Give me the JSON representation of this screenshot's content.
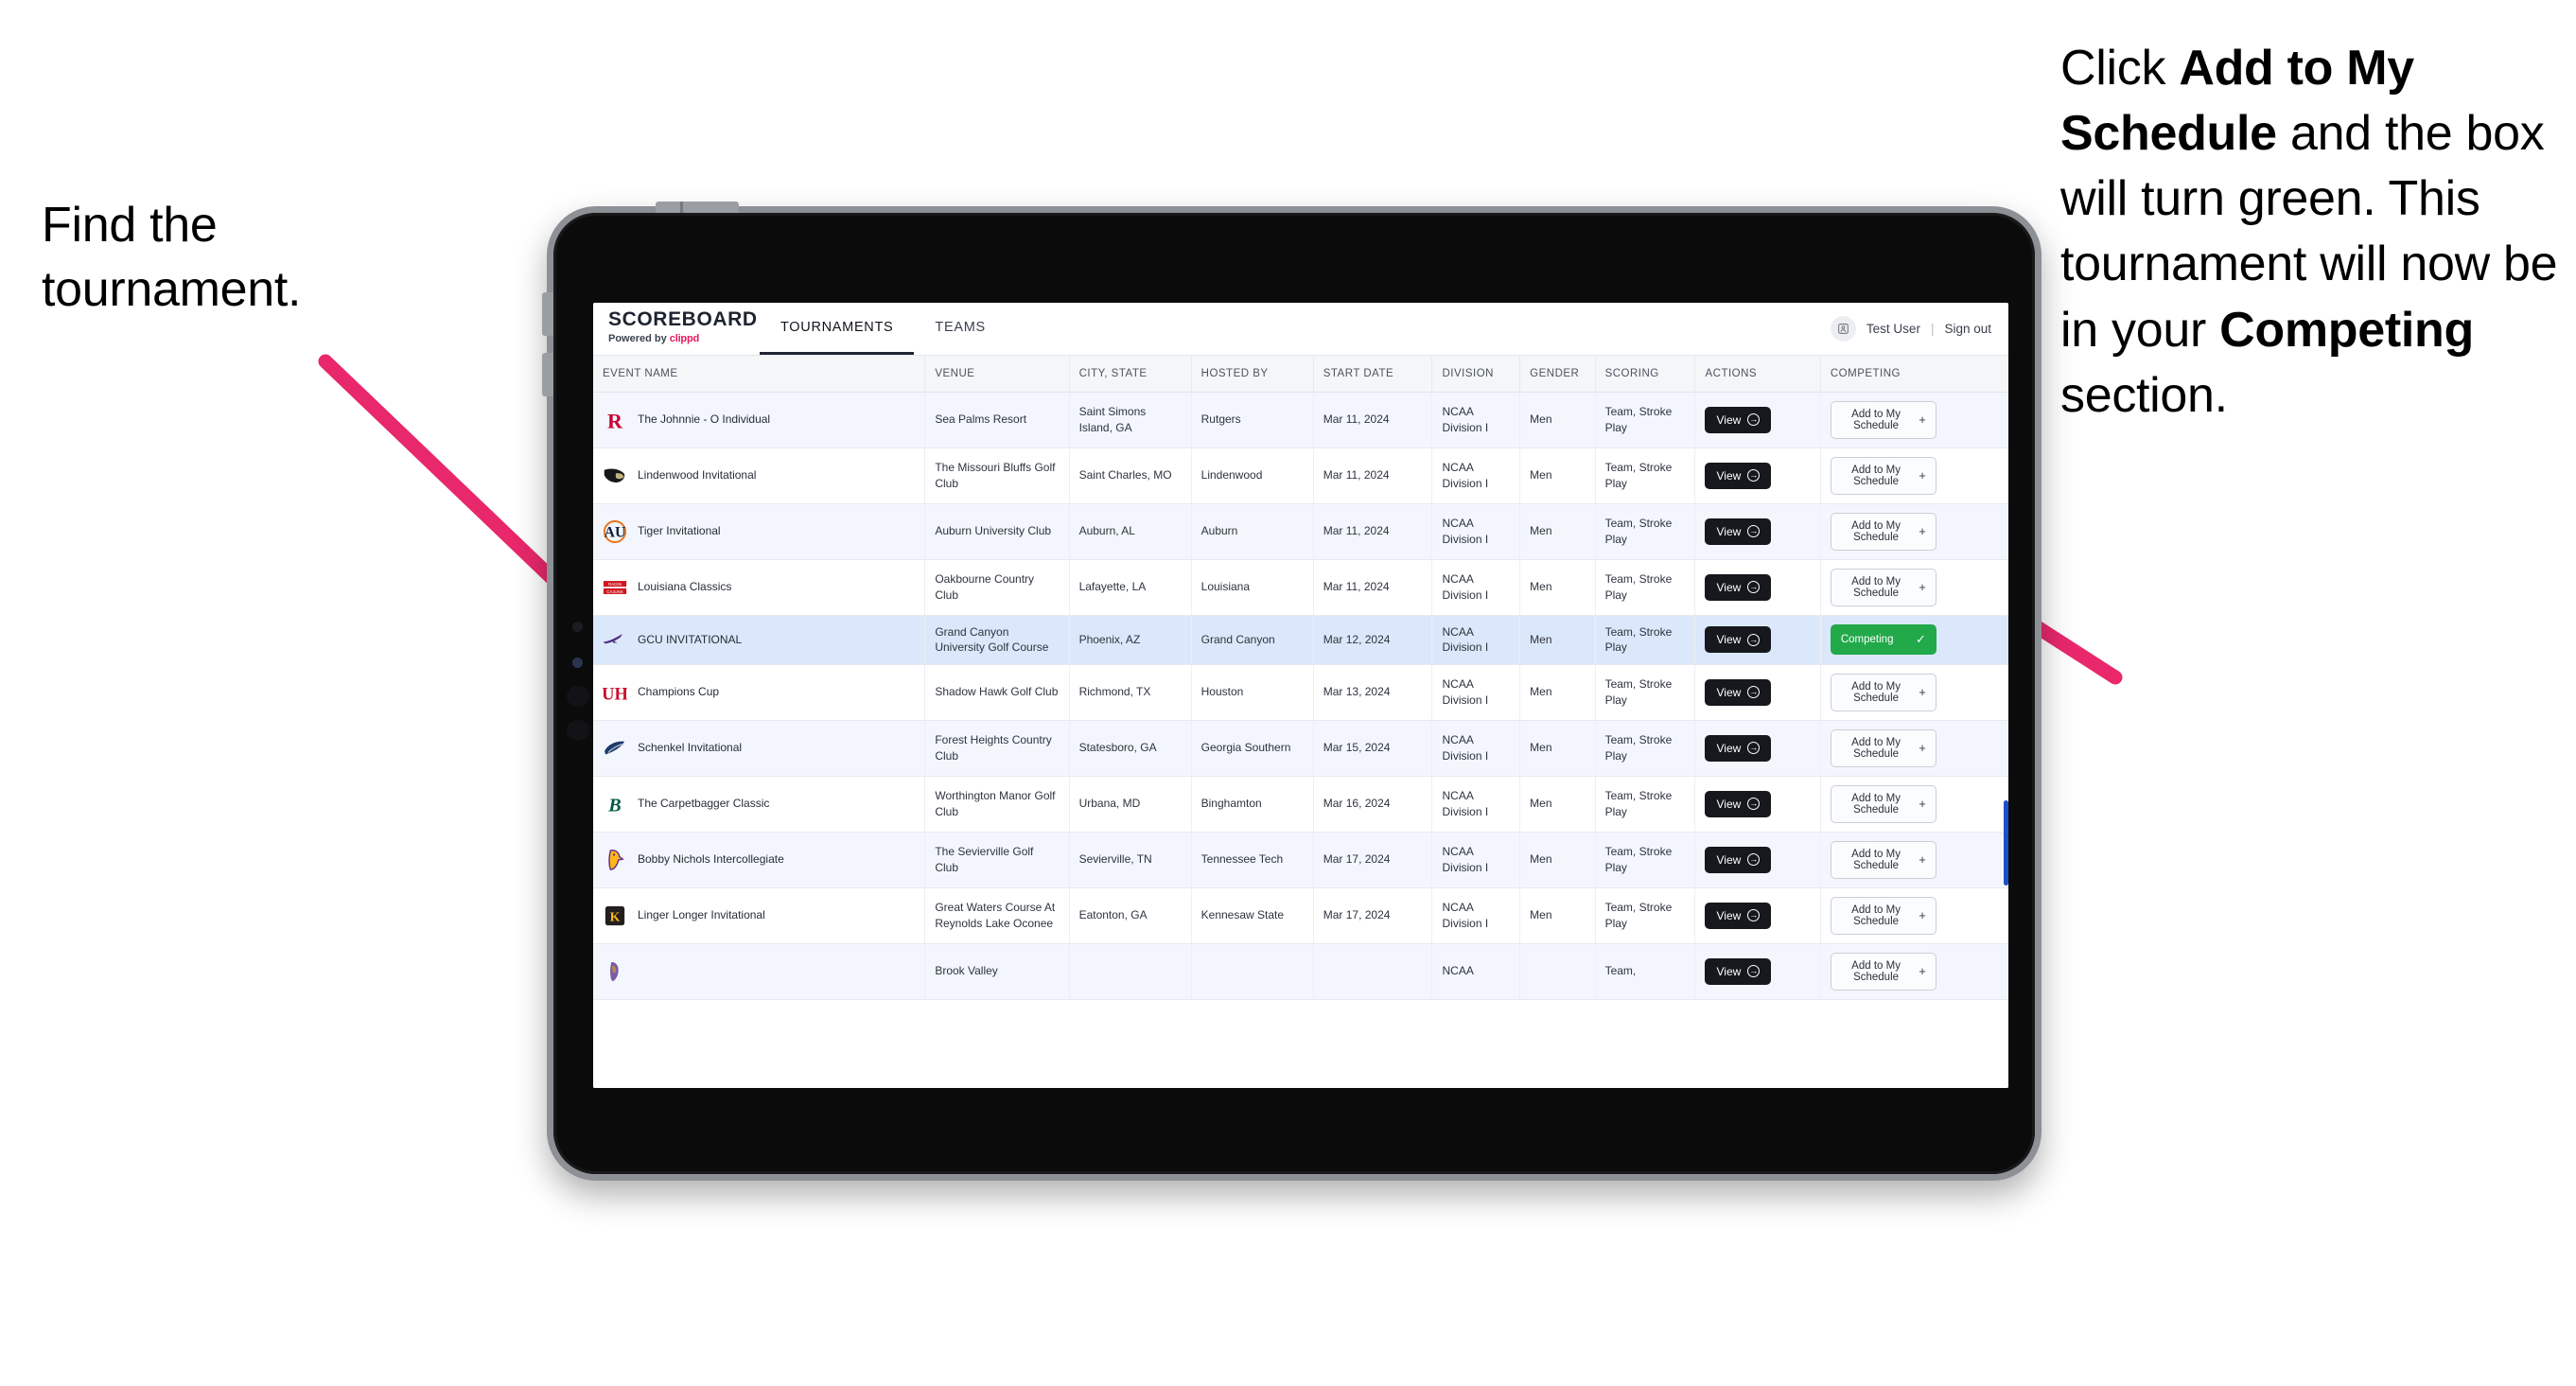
{
  "annotations": {
    "left": "Find the tournament.",
    "right_parts": [
      {
        "text": "Click ",
        "bold": false
      },
      {
        "text": "Add to My Schedule",
        "bold": true
      },
      {
        "text": " and the box will turn green. This tournament will now be in your ",
        "bold": false
      },
      {
        "text": "Competing",
        "bold": true
      },
      {
        "text": " section.",
        "bold": false
      }
    ],
    "arrow_color": "#e8286b"
  },
  "app": {
    "brand": {
      "name": "SCOREBOARD",
      "powered_prefix": "Powered by ",
      "powered_brand": "clippd"
    },
    "tabs": [
      {
        "label": "TOURNAMENTS",
        "active": true
      },
      {
        "label": "TEAMS",
        "active": false
      }
    ],
    "header_right": {
      "avatar_icon": "user-avatar-icon",
      "user": "Test User",
      "separator": "|",
      "signout": "Sign out"
    },
    "columns": [
      "EVENT NAME",
      "VENUE",
      "CITY, STATE",
      "HOSTED BY",
      "START DATE",
      "DIVISION",
      "GENDER",
      "SCORING",
      "ACTIONS",
      "COMPETING"
    ],
    "buttons": {
      "view": "View",
      "add": "Add to My Schedule",
      "add_plus": "+",
      "competing": "Competing",
      "competing_check": "✓"
    },
    "rows": [
      {
        "logo": "rutgers-logo",
        "logo_text": "R",
        "logo_color": "#cc0033",
        "event": "The Johnnie - O Individual",
        "venue": "Sea Palms Resort",
        "city": "Saint Simons Island, GA",
        "host": "Rutgers",
        "date": "Mar 11, 2024",
        "division": "NCAA Division I",
        "gender": "Men",
        "scoring": "Team, Stroke Play",
        "competing": false
      },
      {
        "logo": "lindenwood-lion-logo",
        "logo_text": "",
        "logo_color": "#1d1d1b",
        "event": "Lindenwood Invitational",
        "venue": "The Missouri Bluffs Golf Club",
        "city": "Saint Charles, MO",
        "host": "Lindenwood",
        "date": "Mar 11, 2024",
        "division": "NCAA Division I",
        "gender": "Men",
        "scoring": "Team, Stroke Play",
        "competing": false
      },
      {
        "logo": "auburn-logo",
        "logo_text": "AU",
        "logo_color": "#0c2340",
        "event": "Tiger Invitational",
        "venue": "Auburn University Club",
        "city": "Auburn, AL",
        "host": "Auburn",
        "date": "Mar 11, 2024",
        "division": "NCAA Division I",
        "gender": "Men",
        "scoring": "Team, Stroke Play",
        "competing": false
      },
      {
        "logo": "ragin-cajuns-logo",
        "logo_text": "RAGIN CAJUNS",
        "logo_color": "#ce181e",
        "event": "Louisiana Classics",
        "venue": "Oakbourne Country Club",
        "city": "Lafayette, LA",
        "host": "Louisiana",
        "date": "Mar 11, 2024",
        "division": "NCAA Division I",
        "gender": "Men",
        "scoring": "Team, Stroke Play",
        "competing": false
      },
      {
        "logo": "grand-canyon-lopes-logo",
        "logo_text": "",
        "logo_color": "#4f2d7f",
        "event": "GCU INVITATIONAL",
        "venue": "Grand Canyon University Golf Course",
        "city": "Phoenix, AZ",
        "host": "Grand Canyon",
        "date": "Mar 12, 2024",
        "division": "NCAA Division I",
        "gender": "Men",
        "scoring": "Team, Stroke Play",
        "competing": true
      },
      {
        "logo": "houston-logo",
        "logo_text": "UH",
        "logo_color": "#c8102e",
        "event": "Champions Cup",
        "venue": "Shadow Hawk Golf Club",
        "city": "Richmond, TX",
        "host": "Houston",
        "date": "Mar 13, 2024",
        "division": "NCAA Division I",
        "gender": "Men",
        "scoring": "Team, Stroke Play",
        "competing": false
      },
      {
        "logo": "georgia-southern-logo",
        "logo_text": "GS",
        "logo_color": "#1a3a6b",
        "event": "Schenkel Invitational",
        "venue": "Forest Heights Country Club",
        "city": "Statesboro, GA",
        "host": "Georgia Southern",
        "date": "Mar 15, 2024",
        "division": "NCAA Division I",
        "gender": "Men",
        "scoring": "Team, Stroke Play",
        "competing": false
      },
      {
        "logo": "binghamton-logo",
        "logo_text": "B",
        "logo_color": "#005a43",
        "event": "The Carpetbagger Classic",
        "venue": "Worthington Manor Golf Club",
        "city": "Urbana, MD",
        "host": "Binghamton",
        "date": "Mar 16, 2024",
        "division": "NCAA Division I",
        "gender": "Men",
        "scoring": "Team, Stroke Play",
        "competing": false
      },
      {
        "logo": "tennessee-tech-logo",
        "logo_text": "",
        "logo_color": "#6b2c91",
        "event": "Bobby Nichols Intercollegiate",
        "venue": "The Sevierville Golf Club",
        "city": "Sevierville, TN",
        "host": "Tennessee Tech",
        "date": "Mar 17, 2024",
        "division": "NCAA Division I",
        "gender": "Men",
        "scoring": "Team, Stroke Play",
        "competing": false
      },
      {
        "logo": "kennesaw-state-logo",
        "logo_text": "KS",
        "logo_color": "#fdb913",
        "event": "Linger Longer Invitational",
        "venue": "Great Waters Course At Reynolds Lake Oconee",
        "city": "Eatonton, GA",
        "host": "Kennesaw State",
        "date": "Mar 17, 2024",
        "division": "NCAA Division I",
        "gender": "Men",
        "scoring": "Team, Stroke Play",
        "competing": false
      },
      {
        "logo": "east-carolina-logo",
        "logo_text": "",
        "logo_color": "#4b2e83",
        "event": "",
        "venue": "Brook Valley",
        "city": "",
        "host": "",
        "date": "",
        "division": "NCAA",
        "gender": "",
        "scoring": "Team,",
        "competing": false,
        "cut_off": true
      }
    ]
  }
}
